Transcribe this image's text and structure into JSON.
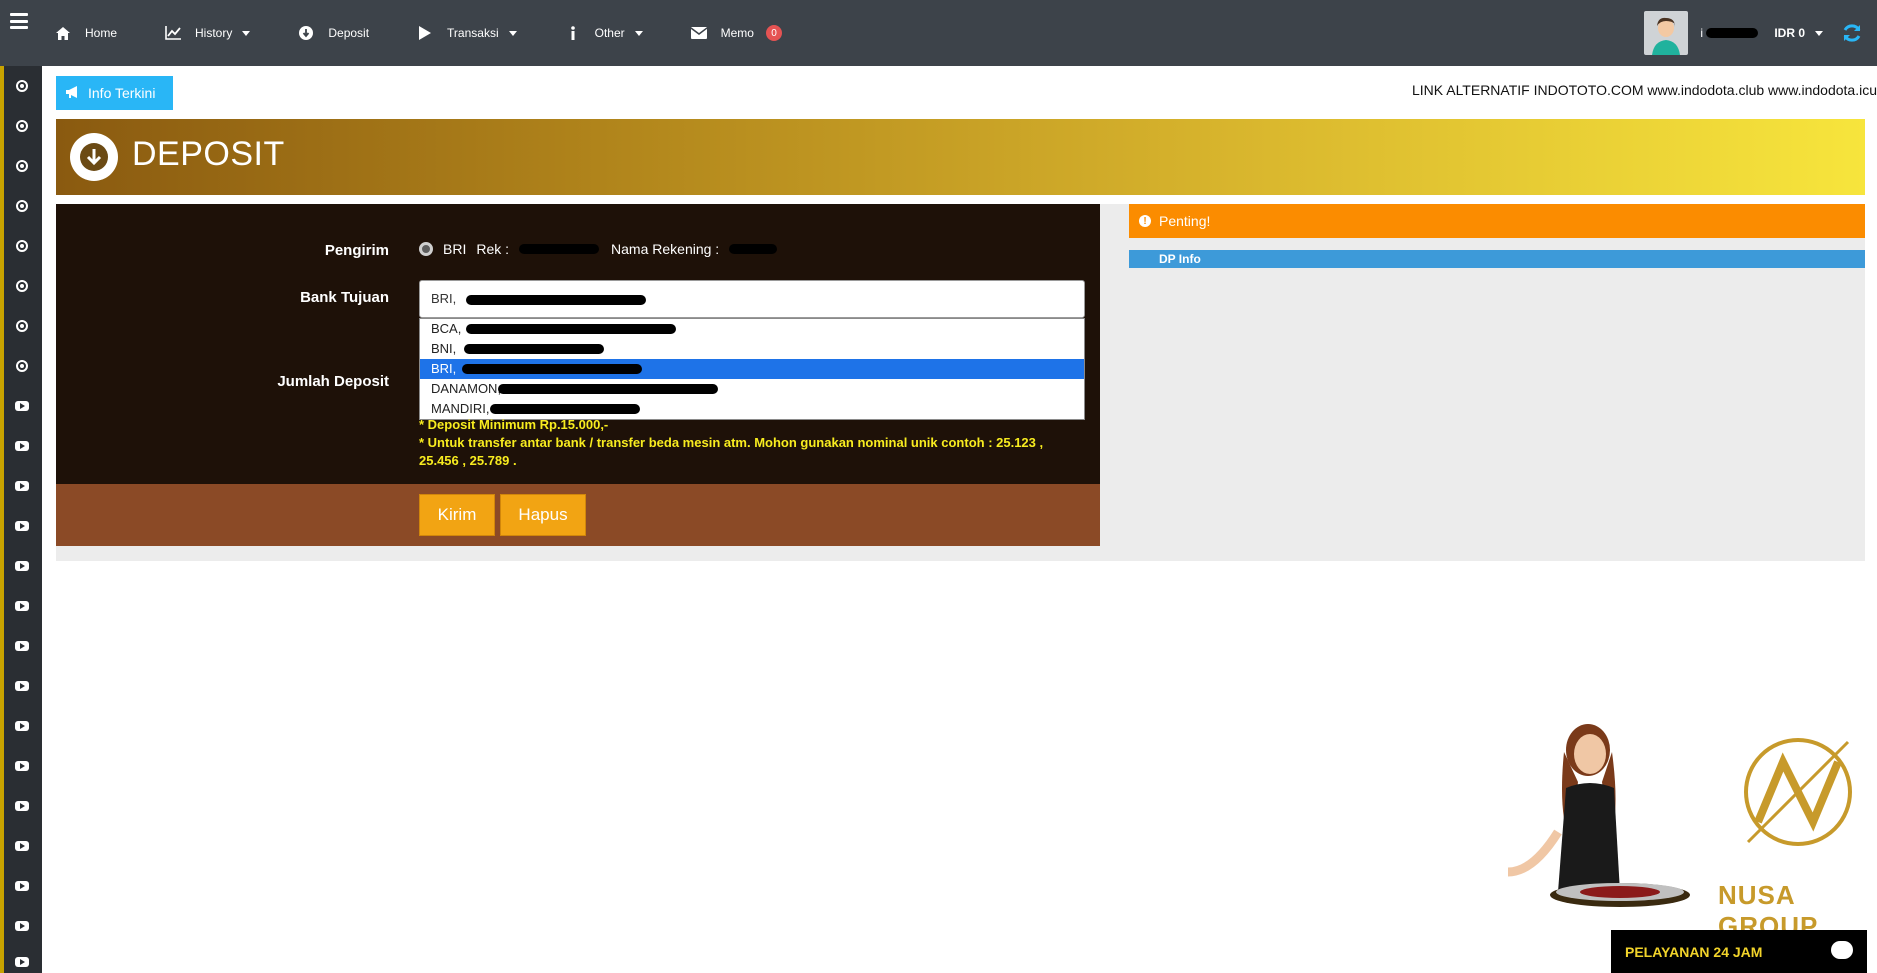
{
  "nav": {
    "items": [
      {
        "label": "Home",
        "icon": "home-icon"
      },
      {
        "label": "History",
        "icon": "chart-icon",
        "caret": true
      },
      {
        "label": "Deposit",
        "icon": "deposit-icon"
      },
      {
        "label": "Transaksi",
        "icon": "play-icon",
        "caret": true
      },
      {
        "label": "Other",
        "icon": "info-icon",
        "caret": true
      },
      {
        "label": "Memo",
        "icon": "envelope-icon"
      }
    ],
    "memo_count": "0"
  },
  "user": {
    "name": "i",
    "balance": "IDR 0"
  },
  "info": {
    "button_label": "Info Terkini",
    "marquee": "LINK ALTERNATIF INDOTOTO.COM www.indodota.club www.indodota.icu"
  },
  "banner": {
    "title": "DEPOSIT"
  },
  "form": {
    "sender_label": "Pengirim",
    "sender_bank": "BRI",
    "sender_rek_label": "Rek :",
    "sender_rek_value": "",
    "sender_name_label": "Nama Rekening :",
    "sender_name_value": "",
    "dest_label": "Bank Tujuan",
    "dest_selected": "BRI,",
    "dest_options": [
      "BCA,",
      "BNI,",
      "BRI,",
      "DANAMON,",
      "MANDIRI,"
    ],
    "amount_label": "Jumlah Deposit",
    "note_min": "* Deposit Minimum Rp.15.000,-",
    "note_unique": "* Untuk transfer antar bank / transfer beda mesin atm. Mohon gunakan nominal unik contoh : 25.123 , 25.456 , 25.789 .",
    "submit_label": "Kirim",
    "reset_label": "Hapus"
  },
  "side": {
    "warning": "Penting!",
    "dp_info": "DP Info"
  },
  "promo": {
    "logo_text": "NUSA GROUP",
    "chat_label": "PELAYANAN 24 JAM"
  },
  "colors": {
    "navbar": "#3d434a",
    "accent_blue": "#29b6f6",
    "orange": "#fb8c00",
    "button": "#f2a413",
    "panel": "#1e1108"
  }
}
